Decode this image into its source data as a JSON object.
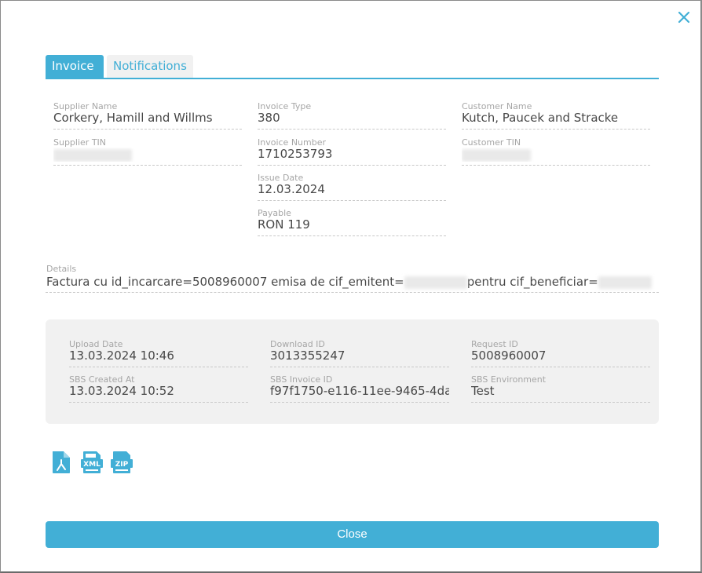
{
  "modal": {
    "close_icon": "close-x-icon",
    "accent_color": "#42afd6"
  },
  "tabs": [
    {
      "label": "Invoice",
      "active": true
    },
    {
      "label": "Notifications",
      "active": false
    }
  ],
  "invoice": {
    "supplier_name": {
      "label": "Supplier Name",
      "value": "Corkery, Hamill and Willms"
    },
    "supplier_tin": {
      "label": "Supplier TIN",
      "value": "[redacted]"
    },
    "invoice_type": {
      "label": "Invoice Type",
      "value": "380"
    },
    "invoice_number": {
      "label": "Invoice Number",
      "value": "1710253793"
    },
    "issue_date": {
      "label": "Issue Date",
      "value": "12.03.2024"
    },
    "payable": {
      "label": "Payable",
      "value": "RON 119"
    },
    "customer_name": {
      "label": "Customer Name",
      "value": "Kutch, Paucek and Stracke"
    },
    "customer_tin": {
      "label": "Customer TIN",
      "value": "[redacted]"
    }
  },
  "details": {
    "label": "Details",
    "part1": "Factura cu id_incarcare=5008960007 emisa de cif_emitent=",
    "part2": "pentru cif_beneficiar="
  },
  "sbs": {
    "upload_date": {
      "label": "Upload Date",
      "value": "13.03.2024 10:46"
    },
    "sbs_created_at": {
      "label": "SBS Created At",
      "value": "13.03.2024 10:52"
    },
    "download_id": {
      "label": "Download ID",
      "value": "3013355247"
    },
    "sbs_invoice_id": {
      "label": "SBS Invoice ID",
      "value": "f97f1750-e116-11ee-9465-4da"
    },
    "request_id": {
      "label": "Request ID",
      "value": "5008960007"
    },
    "sbs_environment": {
      "label": "SBS Environment",
      "value": "Test"
    }
  },
  "files": [
    {
      "icon": "pdf-file-icon",
      "label": ""
    },
    {
      "icon": "xml-file-icon",
      "label": "XML"
    },
    {
      "icon": "zip-file-icon",
      "label": "ZIP"
    }
  ],
  "footer": {
    "close_label": "Close"
  }
}
